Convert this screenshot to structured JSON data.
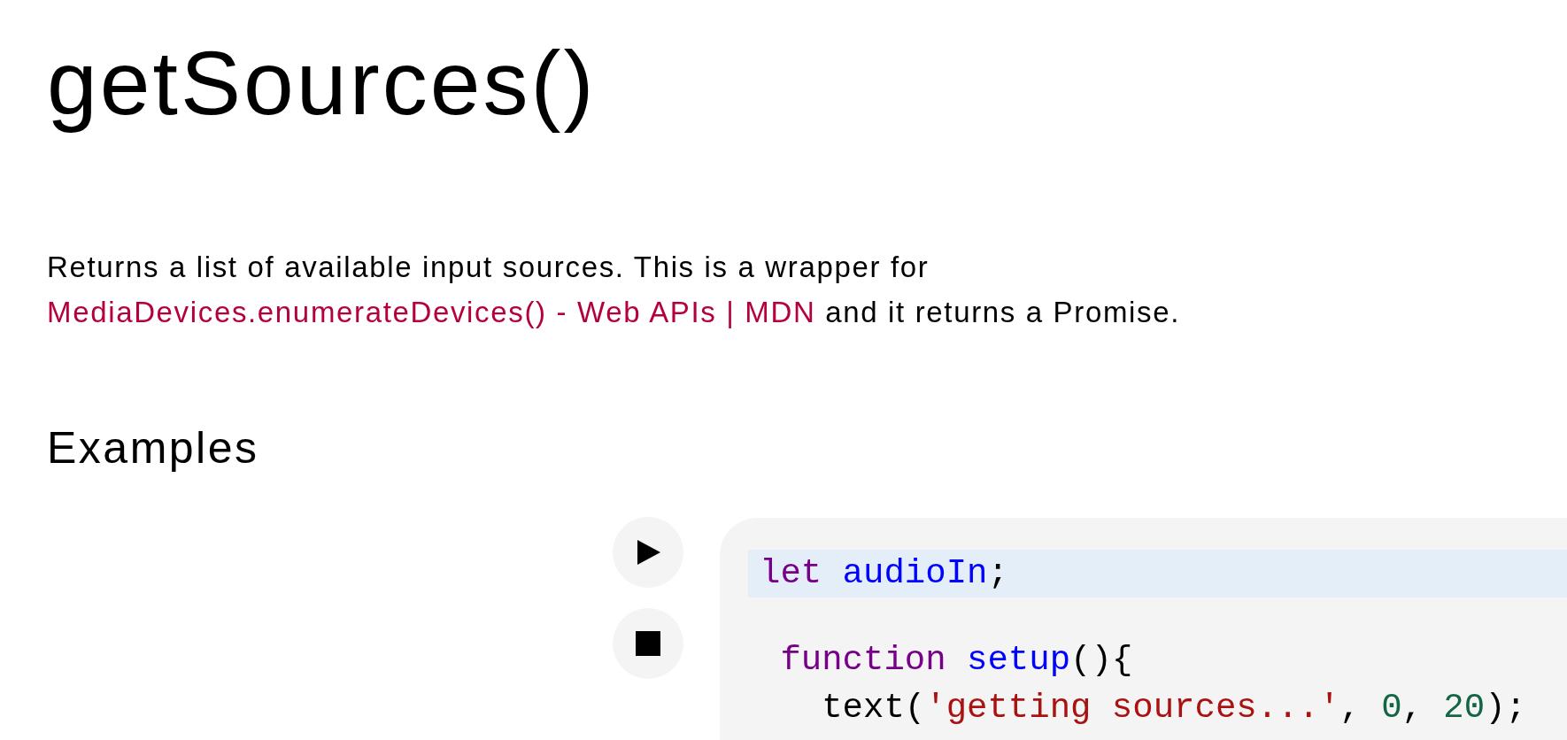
{
  "title": "getSources()",
  "description": {
    "before": "Returns a list of available input sources. This is a wrapper for",
    "link": "MediaDevices.enumerateDevices() - Web APIs | MDN",
    "after": "and it returns a Promise."
  },
  "examples": {
    "heading": "Examples",
    "controls": [
      {
        "kind": "play"
      },
      {
        "kind": "stop"
      }
    ],
    "code_lines": [
      {
        "highlighted": true,
        "tokens": [
          {
            "text": "let",
            "kind": "keyword"
          },
          {
            "text": " audioIn",
            "kind": "def"
          },
          {
            "text": ";",
            "kind": "plain"
          }
        ]
      },
      {
        "highlighted": false
      },
      {
        "highlighted": false,
        "tokens": [
          {
            "text": " function",
            "kind": "keyword"
          },
          {
            "text": " setup",
            "kind": "def"
          },
          {
            "text": "(){",
            "kind": "plain"
          }
        ]
      },
      {
        "highlighted": false,
        "tokens": [
          {
            "text": "   text(",
            "kind": "plain"
          },
          {
            "text": "'getting sources...'",
            "kind": "string"
          },
          {
            "text": ", ",
            "kind": "plain"
          },
          {
            "text": "0",
            "kind": "number"
          },
          {
            "text": ", ",
            "kind": "plain"
          },
          {
            "text": "20",
            "kind": "number"
          },
          {
            "text": ");",
            "kind": "plain"
          }
        ]
      }
    ]
  }
}
